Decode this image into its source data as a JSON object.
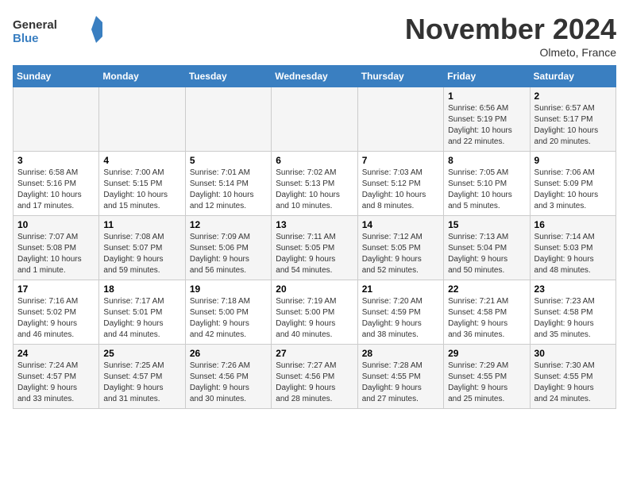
{
  "header": {
    "logo_line1": "General",
    "logo_line2": "Blue",
    "month": "November 2024",
    "location": "Olmeto, France"
  },
  "days_of_week": [
    "Sunday",
    "Monday",
    "Tuesday",
    "Wednesday",
    "Thursday",
    "Friday",
    "Saturday"
  ],
  "weeks": [
    [
      {
        "day": "",
        "info": ""
      },
      {
        "day": "",
        "info": ""
      },
      {
        "day": "",
        "info": ""
      },
      {
        "day": "",
        "info": ""
      },
      {
        "day": "",
        "info": ""
      },
      {
        "day": "1",
        "info": "Sunrise: 6:56 AM\nSunset: 5:19 PM\nDaylight: 10 hours\nand 22 minutes."
      },
      {
        "day": "2",
        "info": "Sunrise: 6:57 AM\nSunset: 5:17 PM\nDaylight: 10 hours\nand 20 minutes."
      }
    ],
    [
      {
        "day": "3",
        "info": "Sunrise: 6:58 AM\nSunset: 5:16 PM\nDaylight: 10 hours\nand 17 minutes."
      },
      {
        "day": "4",
        "info": "Sunrise: 7:00 AM\nSunset: 5:15 PM\nDaylight: 10 hours\nand 15 minutes."
      },
      {
        "day": "5",
        "info": "Sunrise: 7:01 AM\nSunset: 5:14 PM\nDaylight: 10 hours\nand 12 minutes."
      },
      {
        "day": "6",
        "info": "Sunrise: 7:02 AM\nSunset: 5:13 PM\nDaylight: 10 hours\nand 10 minutes."
      },
      {
        "day": "7",
        "info": "Sunrise: 7:03 AM\nSunset: 5:12 PM\nDaylight: 10 hours\nand 8 minutes."
      },
      {
        "day": "8",
        "info": "Sunrise: 7:05 AM\nSunset: 5:10 PM\nDaylight: 10 hours\nand 5 minutes."
      },
      {
        "day": "9",
        "info": "Sunrise: 7:06 AM\nSunset: 5:09 PM\nDaylight: 10 hours\nand 3 minutes."
      }
    ],
    [
      {
        "day": "10",
        "info": "Sunrise: 7:07 AM\nSunset: 5:08 PM\nDaylight: 10 hours\nand 1 minute."
      },
      {
        "day": "11",
        "info": "Sunrise: 7:08 AM\nSunset: 5:07 PM\nDaylight: 9 hours\nand 59 minutes."
      },
      {
        "day": "12",
        "info": "Sunrise: 7:09 AM\nSunset: 5:06 PM\nDaylight: 9 hours\nand 56 minutes."
      },
      {
        "day": "13",
        "info": "Sunrise: 7:11 AM\nSunset: 5:05 PM\nDaylight: 9 hours\nand 54 minutes."
      },
      {
        "day": "14",
        "info": "Sunrise: 7:12 AM\nSunset: 5:05 PM\nDaylight: 9 hours\nand 52 minutes."
      },
      {
        "day": "15",
        "info": "Sunrise: 7:13 AM\nSunset: 5:04 PM\nDaylight: 9 hours\nand 50 minutes."
      },
      {
        "day": "16",
        "info": "Sunrise: 7:14 AM\nSunset: 5:03 PM\nDaylight: 9 hours\nand 48 minutes."
      }
    ],
    [
      {
        "day": "17",
        "info": "Sunrise: 7:16 AM\nSunset: 5:02 PM\nDaylight: 9 hours\nand 46 minutes."
      },
      {
        "day": "18",
        "info": "Sunrise: 7:17 AM\nSunset: 5:01 PM\nDaylight: 9 hours\nand 44 minutes."
      },
      {
        "day": "19",
        "info": "Sunrise: 7:18 AM\nSunset: 5:00 PM\nDaylight: 9 hours\nand 42 minutes."
      },
      {
        "day": "20",
        "info": "Sunrise: 7:19 AM\nSunset: 5:00 PM\nDaylight: 9 hours\nand 40 minutes."
      },
      {
        "day": "21",
        "info": "Sunrise: 7:20 AM\nSunset: 4:59 PM\nDaylight: 9 hours\nand 38 minutes."
      },
      {
        "day": "22",
        "info": "Sunrise: 7:21 AM\nSunset: 4:58 PM\nDaylight: 9 hours\nand 36 minutes."
      },
      {
        "day": "23",
        "info": "Sunrise: 7:23 AM\nSunset: 4:58 PM\nDaylight: 9 hours\nand 35 minutes."
      }
    ],
    [
      {
        "day": "24",
        "info": "Sunrise: 7:24 AM\nSunset: 4:57 PM\nDaylight: 9 hours\nand 33 minutes."
      },
      {
        "day": "25",
        "info": "Sunrise: 7:25 AM\nSunset: 4:57 PM\nDaylight: 9 hours\nand 31 minutes."
      },
      {
        "day": "26",
        "info": "Sunrise: 7:26 AM\nSunset: 4:56 PM\nDaylight: 9 hours\nand 30 minutes."
      },
      {
        "day": "27",
        "info": "Sunrise: 7:27 AM\nSunset: 4:56 PM\nDaylight: 9 hours\nand 28 minutes."
      },
      {
        "day": "28",
        "info": "Sunrise: 7:28 AM\nSunset: 4:55 PM\nDaylight: 9 hours\nand 27 minutes."
      },
      {
        "day": "29",
        "info": "Sunrise: 7:29 AM\nSunset: 4:55 PM\nDaylight: 9 hours\nand 25 minutes."
      },
      {
        "day": "30",
        "info": "Sunrise: 7:30 AM\nSunset: 4:55 PM\nDaylight: 9 hours\nand 24 minutes."
      }
    ]
  ]
}
